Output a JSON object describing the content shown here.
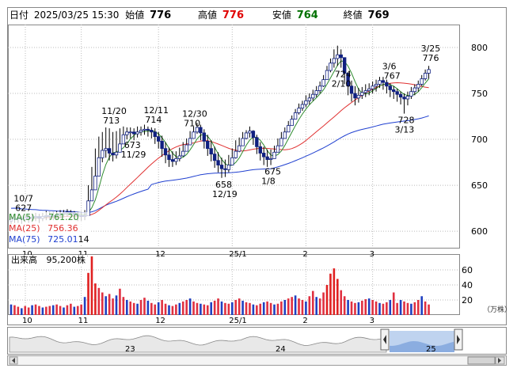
{
  "header": {
    "date_label": "日付",
    "datetime": "2025/03/25 15:30",
    "open_label": "始値",
    "open_value": "776",
    "high_label": "高値",
    "high_value": "776",
    "low_label": "安値",
    "low_value": "764",
    "close_label": "終値",
    "close_value": "769"
  },
  "moving_averages": [
    {
      "label": "MA(5)",
      "value": "761.20",
      "color": "#2e8b2e"
    },
    {
      "label": "MA(25)",
      "value": "756.36",
      "color": "#e03030"
    },
    {
      "label": "MA(75)",
      "value": "725.01",
      "color": "#2040d0"
    }
  ],
  "volume": {
    "label": "出来高",
    "value": "95,200株",
    "unit": "（万株）",
    "ticks": [
      "60",
      "40",
      "20"
    ]
  },
  "price_axis_ticks": [
    "800",
    "750",
    "700",
    "650",
    "600"
  ],
  "x_axis_labels": [
    "10",
    "11",
    "12",
    "25/1",
    "2",
    "3"
  ],
  "navigator_labels": [
    "23",
    "24",
    "25"
  ],
  "annotations": [
    {
      "date": "10/7",
      "value": "627"
    },
    {
      "date": "11/20",
      "value": "713"
    },
    {
      "date": "11/29",
      "value": "673"
    },
    {
      "date": "12/11",
      "value": "714"
    },
    {
      "date": "12/19",
      "value": "658"
    },
    {
      "date": "12/30",
      "value": "710"
    },
    {
      "date": "1/8",
      "value": "675"
    },
    {
      "date": "2/10",
      "value": "724"
    },
    {
      "date": "3/6",
      "value": "767"
    },
    {
      "date": "3/13",
      "value": "728"
    },
    {
      "date": "3/25",
      "value": "776"
    }
  ],
  "ma_partial_suffix": "14",
  "chart_data": {
    "type": "candlestick",
    "price_range": [
      582,
      825
    ],
    "ticks": [
      600,
      650,
      700,
      750,
      800
    ],
    "close": [
      613,
      614,
      614,
      613,
      615,
      614,
      615,
      616,
      614,
      616,
      617,
      617,
      617,
      618,
      619,
      620,
      621,
      620,
      618,
      617,
      616,
      617,
      633,
      645,
      660,
      680,
      688,
      690,
      685,
      683,
      686,
      695,
      705,
      708,
      708,
      706,
      708,
      710,
      711,
      710,
      708,
      703,
      698,
      690,
      683,
      678,
      676,
      679,
      682,
      687,
      694,
      701,
      708,
      713,
      707,
      698,
      690,
      684,
      677,
      672,
      668,
      667,
      672,
      680,
      687,
      693,
      701,
      707,
      709,
      702,
      692,
      685,
      681,
      678,
      679,
      686,
      693,
      701,
      708,
      715,
      722,
      729,
      734,
      738,
      742,
      745,
      749,
      753,
      758,
      765,
      775,
      783,
      788,
      792,
      789,
      772,
      758,
      750,
      745,
      748,
      751,
      753,
      755,
      758,
      760,
      764,
      762,
      758,
      754,
      752,
      749,
      746,
      744,
      747,
      752,
      756,
      760,
      766,
      772,
      776
    ],
    "high": [
      619,
      619,
      619,
      617,
      619,
      618,
      619,
      620,
      619,
      620,
      622,
      621,
      621,
      622,
      623,
      623,
      624,
      623,
      622,
      621,
      621,
      623,
      650,
      670,
      690,
      703,
      708,
      713,
      712,
      708,
      709,
      712,
      714,
      713,
      713,
      712,
      714,
      714,
      716,
      714,
      713,
      712,
      708,
      704,
      697,
      691,
      687,
      687,
      691,
      697,
      701,
      709,
      714,
      718,
      716,
      711,
      705,
      699,
      692,
      686,
      680,
      678,
      683,
      690,
      699,
      702,
      708,
      710,
      714,
      710,
      705,
      697,
      692,
      689,
      689,
      693,
      701,
      708,
      713,
      720,
      726,
      733,
      739,
      742,
      748,
      750,
      754,
      758,
      763,
      770,
      780,
      788,
      798,
      802,
      798,
      789,
      773,
      764,
      758,
      756,
      757,
      760,
      761,
      763,
      765,
      768,
      768,
      765,
      761,
      758,
      755,
      752,
      750,
      752,
      757,
      760,
      764,
      770,
      776,
      780
    ],
    "low": [
      608,
      609,
      609,
      608,
      610,
      609,
      610,
      611,
      609,
      611,
      612,
      612,
      612,
      613,
      614,
      615,
      616,
      614,
      612,
      611,
      611,
      612,
      618,
      635,
      650,
      665,
      675,
      680,
      677,
      676,
      679,
      686,
      695,
      700,
      701,
      699,
      702,
      704,
      705,
      703,
      701,
      695,
      690,
      681,
      674,
      670,
      670,
      672,
      676,
      681,
      688,
      695,
      702,
      706,
      699,
      690,
      682,
      676,
      669,
      664,
      658,
      659,
      664,
      673,
      679,
      686,
      694,
      700,
      702,
      694,
      684,
      677,
      672,
      670,
      672,
      679,
      686,
      694,
      701,
      708,
      715,
      722,
      727,
      731,
      735,
      738,
      742,
      746,
      750,
      757,
      765,
      773,
      778,
      780,
      778,
      760,
      748,
      741,
      737,
      740,
      744,
      746,
      748,
      750,
      752,
      756,
      754,
      750,
      746,
      744,
      741,
      738,
      728,
      737,
      744,
      748,
      752,
      758,
      764,
      766
    ],
    "volume": [
      14,
      13,
      11,
      9,
      12,
      10,
      13,
      14,
      12,
      10,
      11,
      12,
      13,
      14,
      12,
      10,
      13,
      15,
      11,
      12,
      14,
      24,
      56,
      78,
      42,
      36,
      30,
      25,
      28,
      22,
      26,
      35,
      24,
      20,
      18,
      16,
      15,
      20,
      23,
      19,
      16,
      14,
      17,
      20,
      15,
      13,
      12,
      14,
      16,
      18,
      20,
      22,
      18,
      16,
      15,
      14,
      13,
      17,
      19,
      22,
      18,
      16,
      15,
      17,
      20,
      22,
      19,
      17,
      16,
      14,
      13,
      15,
      17,
      18,
      16,
      14,
      15,
      18,
      20,
      22,
      24,
      26,
      22,
      20,
      18,
      25,
      32,
      24,
      22,
      30,
      40,
      55,
      62,
      48,
      33,
      25,
      20,
      18,
      16,
      17,
      19,
      21,
      22,
      20,
      18,
      16,
      15,
      17,
      20,
      30,
      16,
      20,
      18,
      16,
      15,
      17,
      20,
      25,
      18,
      14
    ]
  }
}
